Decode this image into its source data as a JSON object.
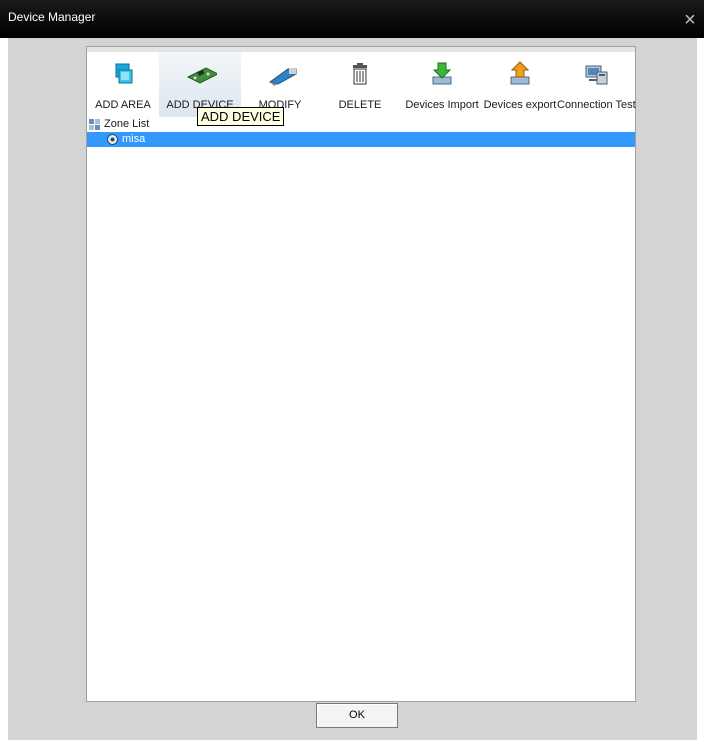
{
  "window": {
    "title": "Device Manager",
    "close_glyph": "×"
  },
  "toolbar": {
    "buttons": [
      {
        "label": "ADD AREA",
        "icon": "area-icon"
      },
      {
        "label": "ADD DEVICE",
        "icon": "device-board-icon",
        "active": true
      },
      {
        "label": "MODIFY",
        "icon": "pen-icon"
      },
      {
        "label": "DELETE",
        "icon": "trash-icon"
      },
      {
        "label": "Devices Import",
        "icon": "import-icon"
      },
      {
        "label": "Devices export",
        "icon": "export-icon"
      },
      {
        "label": "Connection Test",
        "icon": "connection-test-icon"
      }
    ]
  },
  "tooltip": {
    "text": "ADD DEVICE"
  },
  "tree": {
    "root_label": "Zone List",
    "items": [
      {
        "label": "misa",
        "selected": true
      }
    ]
  },
  "footer": {
    "ok_label": "OK"
  },
  "colors": {
    "selection": "#3399ff",
    "tooltip_bg": "#ffffe1",
    "titlebar": "#000000",
    "client_bg": "#d4d4d4"
  }
}
